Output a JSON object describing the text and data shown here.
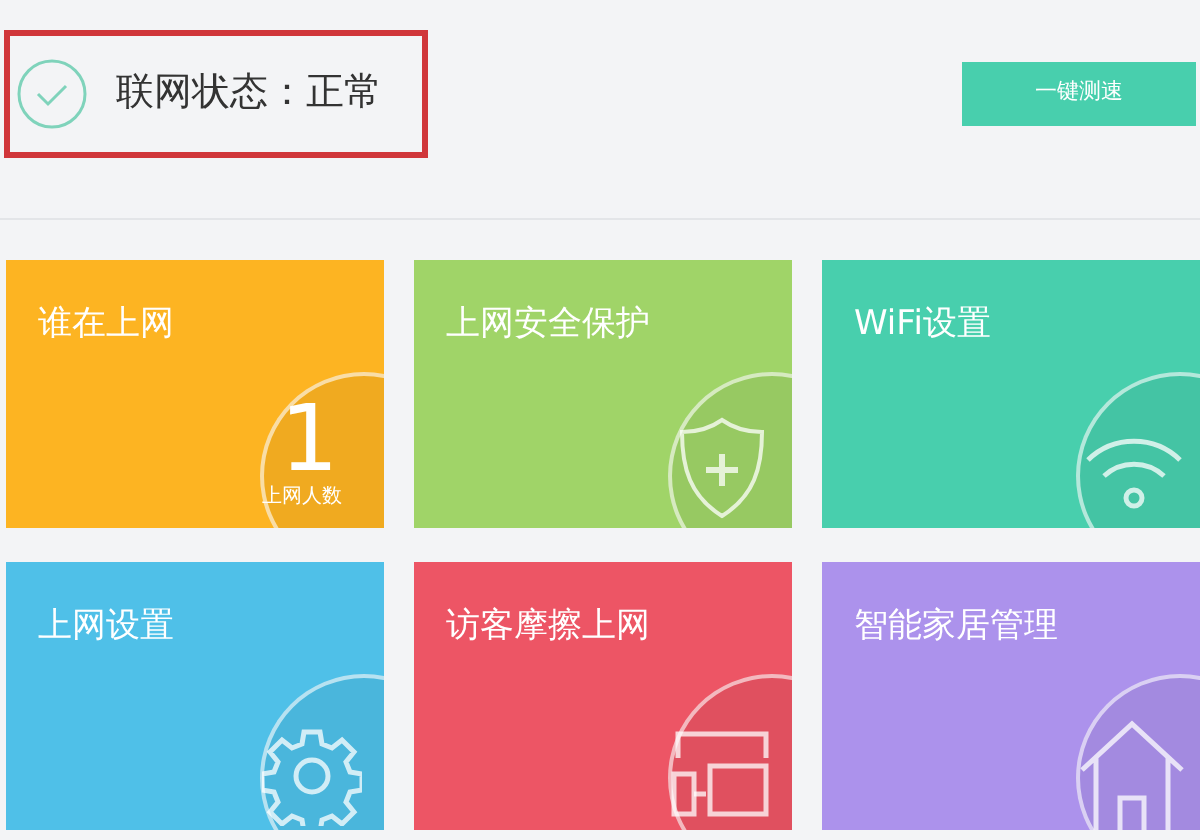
{
  "status": {
    "label": "联网状态：正常",
    "highlighted": true
  },
  "speed_test_button": "一键测速",
  "tiles": [
    {
      "title": "谁在上网",
      "kind": "count",
      "color": "#fdb422",
      "value": "1",
      "caption": "上网人数"
    },
    {
      "title": "上网安全保护",
      "kind": "shield",
      "color": "#a0d468"
    },
    {
      "title": "WiFi设置",
      "kind": "wifi",
      "color": "#48cfad"
    },
    {
      "title": "上网设置",
      "kind": "gear",
      "color": "#4fc0e8"
    },
    {
      "title": "访客摩擦上网",
      "kind": "devices",
      "color": "#ed5565"
    },
    {
      "title": "智能家居管理",
      "kind": "home",
      "color": "#ac92ec"
    }
  ]
}
